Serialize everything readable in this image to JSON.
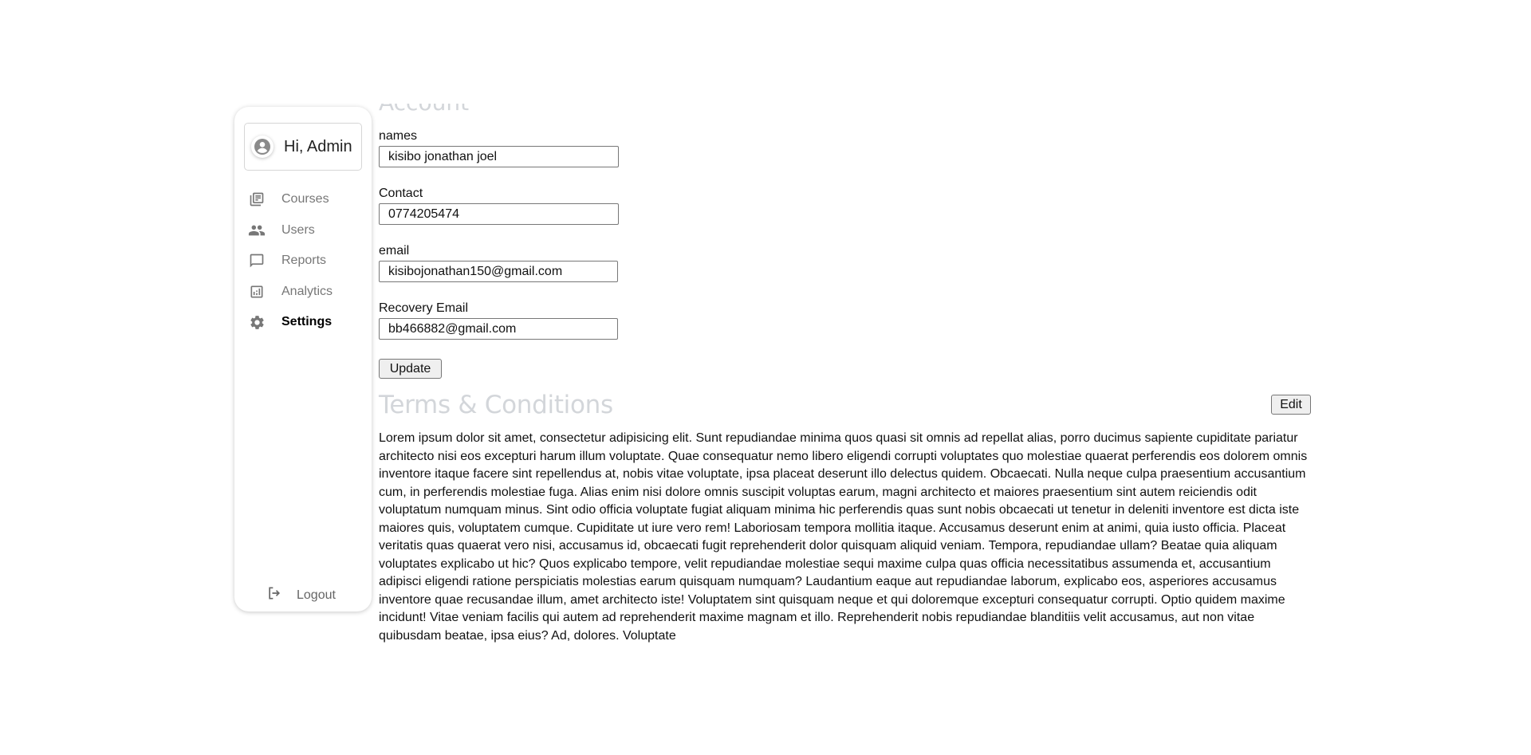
{
  "sidebar": {
    "greeting": "Hi, Admin",
    "items": [
      {
        "label": "Courses",
        "icon": "library-books-icon",
        "active": false
      },
      {
        "label": "Users",
        "icon": "people-icon",
        "active": false
      },
      {
        "label": "Reports",
        "icon": "chat-bubble-icon",
        "active": false
      },
      {
        "label": "Analytics",
        "icon": "analytics-icon",
        "active": false
      },
      {
        "label": "Settings",
        "icon": "gear-icon",
        "active": true
      }
    ],
    "logout_label": "Logout"
  },
  "account": {
    "title": "Account",
    "fields": [
      {
        "label": "names",
        "value": "kisibo jonathan joel"
      },
      {
        "label": "Contact",
        "value": "0774205474"
      },
      {
        "label": "email",
        "value": "kisibojonathan150@gmail.com"
      },
      {
        "label": "Recovery Email",
        "value": "bb466882@gmail.com"
      }
    ],
    "update_label": "Update"
  },
  "terms": {
    "title": "Terms & Conditions",
    "edit_label": "Edit",
    "body": "Lorem ipsum dolor sit amet, consectetur adipisicing elit. Sunt repudiandae minima quos quasi sit omnis ad repellat alias, porro ducimus sapiente cupiditate pariatur architecto nisi eos excepturi harum illum voluptate. Quae consequatur nemo libero eligendi corrupti voluptates quo molestiae quaerat perferendis eos dolorem omnis inventore itaque facere sint repellendus at, nobis vitae voluptate, ipsa placeat deserunt illo delectus quidem. Obcaecati. Nulla neque culpa praesentium accusantium cum, in perferendis molestiae fuga. Alias enim nisi dolore omnis suscipit voluptas earum, magni architecto et maiores praesentium sint autem reiciendis odit voluptatum numquam minus. Sint odio officia voluptate fugiat aliquam minima hic perferendis quas sunt nobis obcaecati ut tenetur in deleniti inventore est dicta iste maiores quis, voluptatem cumque. Cupiditate ut iure vero rem! Laboriosam tempora mollitia itaque. Accusamus deserunt enim at animi, quia iusto officia. Placeat veritatis quas quaerat vero nisi, accusamus id, obcaecati fugit reprehenderit dolor quisquam aliquid veniam. Tempora, repudiandae ullam? Beatae quia aliquam voluptates explicabo ut hic? Quos explicabo tempore, velit repudiandae molestiae sequi maxime culpa quas officia necessitatibus assumenda et, accusantium adipisci eligendi ratione perspiciatis molestias earum quisquam numquam? Laudantium eaque aut repudiandae laborum, explicabo eos, asperiores accusamus inventore quae recusandae illum, amet architecto iste! Voluptatem sint quisquam neque et qui doloremque excepturi consequatur corrupti. Optio quidem maxime incidunt! Vitae veniam facilis qui autem ad reprehenderit maxime magnam et illo. Reprehenderit nobis repudiandae blanditiis velit accusamus, aut non vitae quibusdam beatae, ipsa eius? Ad, dolores. Voluptate"
  }
}
